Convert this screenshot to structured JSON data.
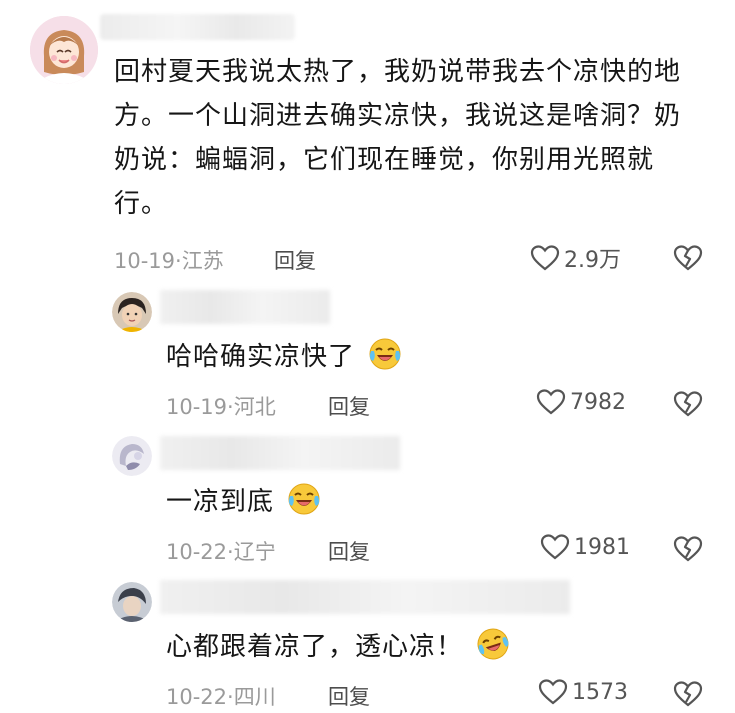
{
  "comments": [
    {
      "text": "回村夏天我说太热了，我奶说带我去个凉快的地方。一个山洞进去确实凉快，我说这是啥洞？奶奶说：蝙蝠洞，它们现在睡觉，你别用光照就行。",
      "lines": [
        "回村夏天我说太热了，我奶说带我去个凉快的地",
        "方。一个山洞进去确实凉快，我说这是啥洞？奶",
        "奶说：蝙蝠洞，它们现在睡觉，你别用光照就",
        "行。"
      ],
      "date": "10-19",
      "location": "江苏",
      "reply_label": "回复",
      "likes": "2.9万"
    },
    {
      "text": "哈哈确实凉快了",
      "emoji": "laughing-crying-emoji",
      "date": "10-19",
      "location": "河北",
      "reply_label": "回复",
      "likes": "7982"
    },
    {
      "text": "一凉到底",
      "emoji": "laughing-crying-emoji",
      "date": "10-22",
      "location": "辽宁",
      "reply_label": "回复",
      "likes": "1981"
    },
    {
      "text": "心都跟着凉了，透心凉！",
      "emoji": "laughing-crying-emoji",
      "date": "10-22",
      "location": "四川",
      "reply_label": "回复",
      "likes": "1573"
    }
  ],
  "meta_separator": "·",
  "icons": {
    "like": "heart-outline-icon",
    "dislike": "broken-heart-icon"
  }
}
